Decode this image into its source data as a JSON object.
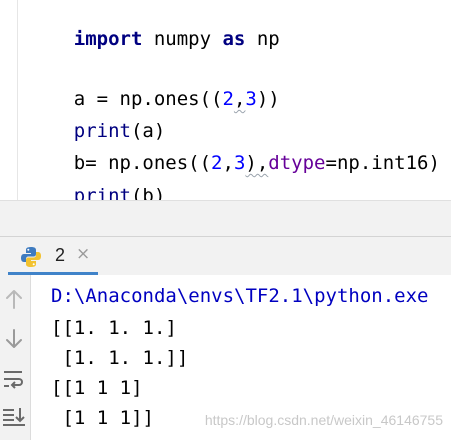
{
  "editor": {
    "lines": [
      {
        "parts": [
          [
            "kw",
            "import"
          ],
          [
            "plain",
            " numpy "
          ],
          [
            "kw",
            "as"
          ],
          [
            "plain",
            " np"
          ]
        ]
      },
      {
        "parts": []
      },
      {
        "parts": [
          [
            "plain",
            "a = np.ones(("
          ],
          [
            "num",
            "2"
          ],
          [
            "plain",
            ","
          ],
          [
            "num",
            "3"
          ],
          [
            "plain",
            "))"
          ]
        ]
      },
      {
        "parts": [
          [
            "fn",
            "print"
          ],
          [
            "plain",
            "(a)"
          ]
        ]
      },
      {
        "parts": [
          [
            "plain",
            "b= np.ones(("
          ],
          [
            "num",
            "2"
          ],
          [
            "plain",
            ","
          ],
          [
            "num",
            "3"
          ],
          [
            "plain",
            "),"
          ],
          [
            "param",
            "dtype"
          ],
          [
            "plain",
            "=np.int16)"
          ]
        ]
      },
      {
        "parts": [
          [
            "fn",
            "print"
          ],
          [
            "plain",
            "(b)"
          ]
        ]
      }
    ]
  },
  "run_tab": {
    "icon": "python-icon",
    "label": "2",
    "close_glyph": "×"
  },
  "toolbar": {
    "icons": [
      "arrow-up-icon",
      "arrow-down-icon",
      "soft-wrap-icon",
      "scroll-to-end-icon"
    ]
  },
  "console": {
    "path": "D:\\Anaconda\\envs\\TF2.1\\python.exe",
    "lines": [
      "[[1. 1. 1.]",
      " [1. 1. 1.]]",
      "[[1 1 1]",
      " [1 1 1]]"
    ]
  },
  "watermark": "https://blog.csdn.net/weixin_46146755",
  "colors": {
    "keyword": "#000080",
    "number": "#0000ff",
    "param": "#660099",
    "path": "#0000c0",
    "tab_accent": "#4083c9"
  }
}
